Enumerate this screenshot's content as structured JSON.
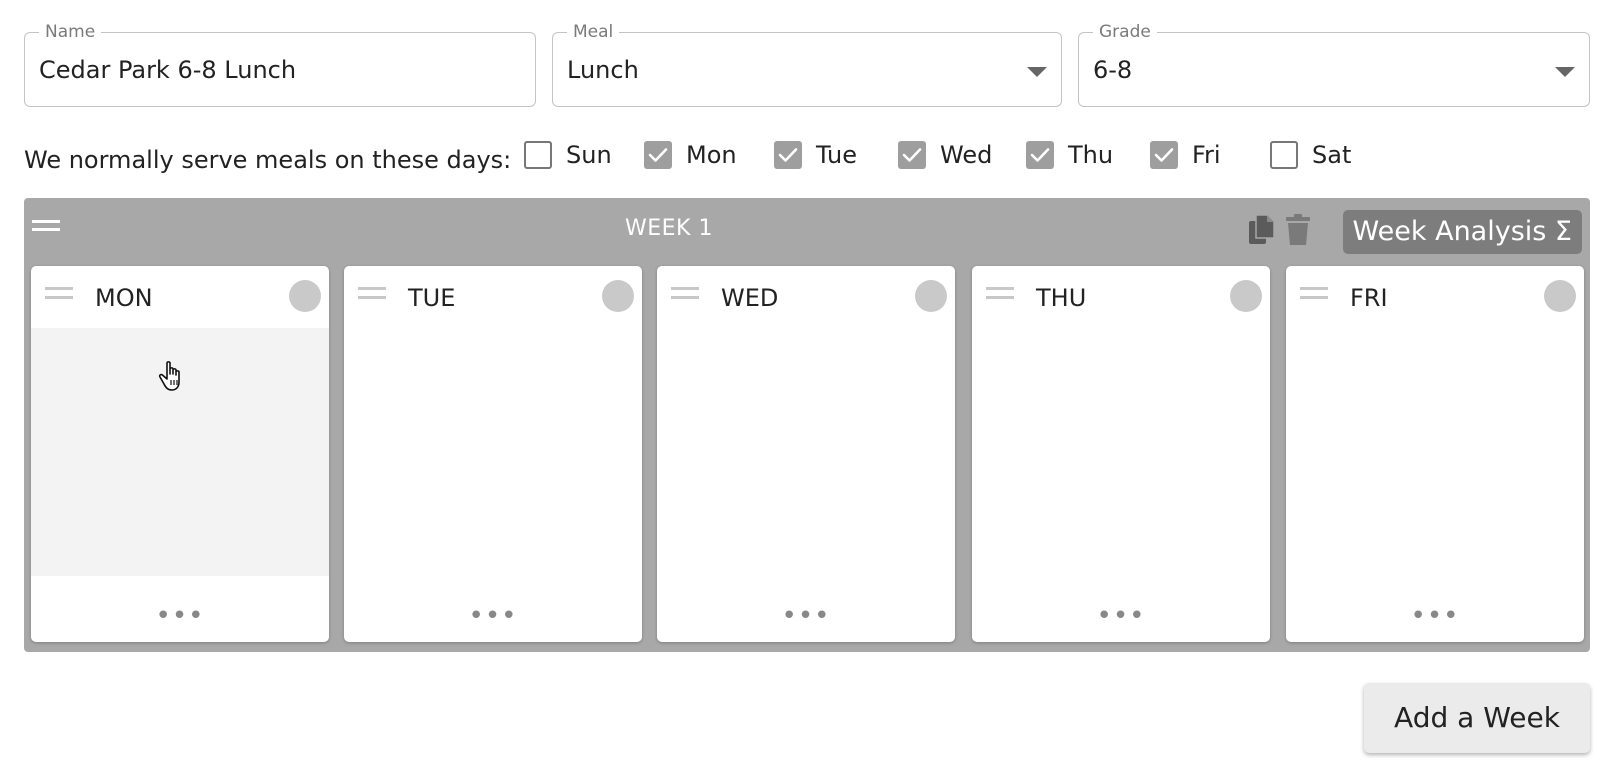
{
  "fields": {
    "name": {
      "label": "Name",
      "value": "Cedar Park 6-8 Lunch"
    },
    "meal": {
      "label": "Meal",
      "value": "Lunch"
    },
    "grade": {
      "label": "Grade",
      "value": "6-8"
    }
  },
  "days_prompt": "We normally serve meals on these days:",
  "days": [
    {
      "label": "Sun",
      "checked": false
    },
    {
      "label": "Mon",
      "checked": true
    },
    {
      "label": "Tue",
      "checked": true
    },
    {
      "label": "Wed",
      "checked": true
    },
    {
      "label": "Thu",
      "checked": true
    },
    {
      "label": "Fri",
      "checked": true
    },
    {
      "label": "Sat",
      "checked": false
    }
  ],
  "week": {
    "title": "WEEK 1",
    "analysis_label": "Week Analysis Σ",
    "cards": [
      {
        "name": "MON",
        "more": "•••"
      },
      {
        "name": "TUE",
        "more": "•••"
      },
      {
        "name": "WED",
        "more": "•••"
      },
      {
        "name": "THU",
        "more": "•••"
      },
      {
        "name": "FRI",
        "more": "•••"
      }
    ]
  },
  "add_week_label": "Add a Week",
  "icons": {
    "copy": "copy-icon",
    "delete": "trash-icon",
    "drag": "drag-handle-icon"
  },
  "colors": {
    "week_bg": "#a8a8a8",
    "analysis_bg": "#7d7d7d",
    "checkbox_checked": "#9e9e9e"
  }
}
